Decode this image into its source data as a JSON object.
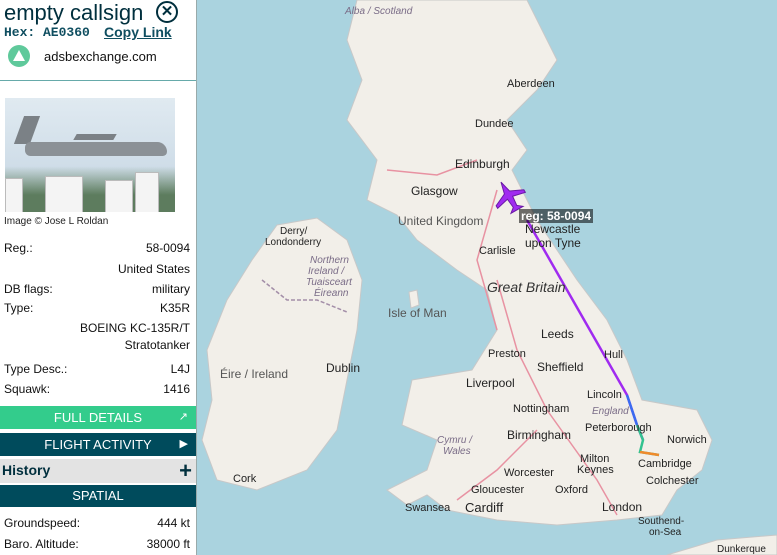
{
  "header": {
    "callsign": "empty callsign",
    "close_label": "✕",
    "hex_label": "Hex: AE0360",
    "copy_link": "Copy Link"
  },
  "source": {
    "name": "adsbexchange.com",
    "icon": "adsbexchange-icon"
  },
  "photo": {
    "credit": "Image © Jose L Roldan"
  },
  "details": [
    {
      "key": "Reg.:",
      "value": "58-0094"
    },
    {
      "key": "",
      "value": "United States"
    },
    {
      "key": "DB flags:",
      "value": "military"
    },
    {
      "key": "Type:",
      "value": "K35R"
    },
    {
      "key": "",
      "value": "BOEING KC-135R/T"
    },
    {
      "key": "",
      "value": "Stratotanker"
    },
    {
      "key": "Type Desc.:",
      "value": "L4J"
    },
    {
      "key": "Squawk:",
      "value": "1416"
    }
  ],
  "buttons": {
    "full_details": "FULL DETAILS",
    "flight_activity": "FLIGHT ACTIVITY",
    "history": "History",
    "spatial": "SPATIAL"
  },
  "spatial": [
    {
      "key": "Groundspeed:",
      "value": "444 kt"
    },
    {
      "key": "Baro. Altitude:",
      "value": "38000 ft"
    }
  ],
  "map": {
    "aircraft_label": "reg: 58-0094",
    "places": {
      "alba": "Alba / Scotland",
      "aberdeen": "Aberdeen",
      "dundee": "Dundee",
      "edinburgh": "Edinburgh",
      "glasgow": "Glasgow",
      "uk": "United Kingdom",
      "newcastle1": "Newcastle",
      "newcastle2": "upon Tyne",
      "derry1": "Derry/",
      "derry2": "Londonderry",
      "ni1": "Northern",
      "ni2": "Ireland /",
      "ni3": "Tuaisceart",
      "ni4": "Éireann",
      "carlisle": "Carlisle",
      "gb": "Great Britain",
      "iom": "Isle of Man",
      "leeds": "Leeds",
      "preston": "Preston",
      "hull": "Hull",
      "dublin": "Dublin",
      "eire": "Éire / Ireland",
      "liverpool": "Liverpool",
      "sheffield": "Sheffield",
      "lincoln": "Lincoln",
      "nottingham": "Nottingham",
      "england": "England",
      "peterborough": "Peterborough",
      "norwich": "Norwich",
      "cymru1": "Cymru /",
      "cymru2": "Wales",
      "birmingham": "Birmingham",
      "cambridge": "Cambridge",
      "cork": "Cork",
      "milton1": "Milton",
      "milton2": "Keynes",
      "worcester": "Worcester",
      "colchester": "Colchester",
      "gloucester": "Gloucester",
      "oxford": "Oxford",
      "swansea": "Swansea",
      "cardiff": "Cardiff",
      "london": "London",
      "southend1": "Southend-",
      "southend2": "on-Sea",
      "dunkerque": "Dunkerque"
    }
  }
}
